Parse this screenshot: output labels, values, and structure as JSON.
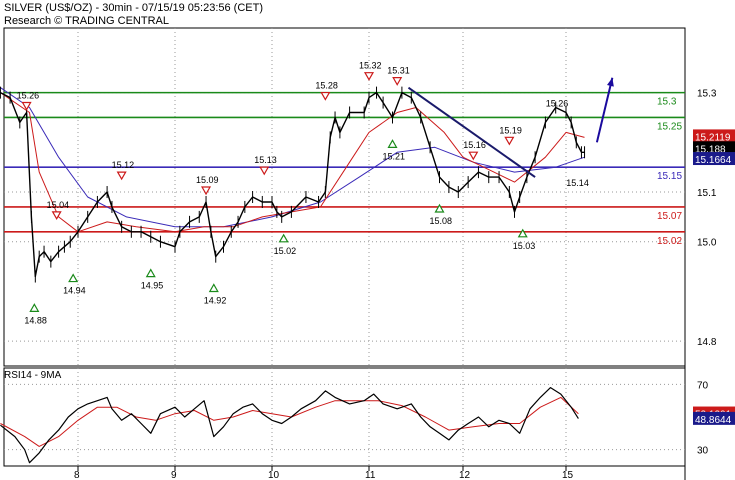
{
  "header": {
    "line1": "SILVER (US$/OZ) - 30min - 07/15/19 05:23:56 (CET)",
    "line2": "Research © TRADING CENTRAL"
  },
  "chart_data": [
    {
      "type": "line",
      "panel": "price",
      "ylim": [
        14.75,
        15.43
      ],
      "x_range": [
        7.2,
        16.2
      ],
      "yticks": [
        14.8,
        15.0,
        15.1,
        15.3
      ],
      "price_series": [
        [
          7.2,
          15.3
        ],
        [
          7.3,
          15.29
        ],
        [
          7.4,
          15.24
        ],
        [
          7.47,
          15.26
        ],
        [
          7.52,
          15.05
        ],
        [
          7.56,
          14.93
        ],
        [
          7.6,
          14.97
        ],
        [
          7.65,
          14.98
        ],
        [
          7.72,
          14.96
        ],
        [
          7.8,
          14.98
        ],
        [
          7.86,
          14.99
        ],
        [
          7.92,
          15.0
        ],
        [
          8.0,
          15.02
        ],
        [
          8.1,
          15.05
        ],
        [
          8.2,
          15.08
        ],
        [
          8.3,
          15.1
        ],
        [
          8.35,
          15.07
        ],
        [
          8.45,
          15.03
        ],
        [
          8.55,
          15.02
        ],
        [
          8.65,
          15.02
        ],
        [
          8.75,
          15.01
        ],
        [
          8.85,
          15.0
        ],
        [
          9.0,
          14.99
        ],
        [
          9.05,
          15.02
        ],
        [
          9.15,
          15.04
        ],
        [
          9.25,
          15.05
        ],
        [
          9.32,
          15.08
        ],
        [
          9.37,
          15.02
        ],
        [
          9.42,
          14.97
        ],
        [
          9.5,
          14.99
        ],
        [
          9.58,
          15.02
        ],
        [
          9.65,
          15.04
        ],
        [
          9.72,
          15.07
        ],
        [
          9.8,
          15.09
        ],
        [
          9.9,
          15.08
        ],
        [
          10.0,
          15.08
        ],
        [
          10.05,
          15.06
        ],
        [
          10.1,
          15.05
        ],
        [
          10.2,
          15.06
        ],
        [
          10.35,
          15.09
        ],
        [
          10.48,
          15.08
        ],
        [
          10.55,
          15.1
        ],
        [
          10.6,
          15.21
        ],
        [
          10.65,
          15.25
        ],
        [
          10.7,
          15.22
        ],
        [
          10.8,
          15.26
        ],
        [
          10.95,
          15.26
        ],
        [
          11.0,
          15.29
        ],
        [
          11.08,
          15.3
        ],
        [
          11.15,
          15.28
        ],
        [
          11.25,
          15.25
        ],
        [
          11.35,
          15.3
        ],
        [
          11.45,
          15.29
        ],
        [
          11.55,
          15.25
        ],
        [
          11.65,
          15.19
        ],
        [
          11.75,
          15.13
        ],
        [
          11.85,
          15.11
        ],
        [
          11.95,
          15.1
        ],
        [
          12.05,
          15.12
        ],
        [
          12.15,
          15.14
        ],
        [
          12.25,
          15.13
        ],
        [
          12.35,
          15.13
        ],
        [
          12.45,
          15.1
        ],
        [
          12.5,
          15.06
        ],
        [
          12.55,
          15.09
        ],
        [
          12.62,
          15.13
        ],
        [
          12.7,
          15.17
        ],
        [
          12.8,
          15.24
        ],
        [
          12.9,
          15.27
        ],
        [
          13.0,
          15.26
        ],
        [
          13.05,
          15.24
        ],
        [
          13.1,
          15.2
        ],
        [
          13.15,
          15.18
        ],
        [
          13.18,
          15.18
        ]
      ],
      "ma_series": [
        [
          7.2,
          15.3
        ],
        [
          7.5,
          15.26
        ],
        [
          7.6,
          15.14
        ],
        [
          7.8,
          15.05
        ],
        [
          8.0,
          15.02
        ],
        [
          8.3,
          15.04
        ],
        [
          8.6,
          15.03
        ],
        [
          9.0,
          15.02
        ],
        [
          9.3,
          15.03
        ],
        [
          9.6,
          15.03
        ],
        [
          9.9,
          15.05
        ],
        [
          10.2,
          15.06
        ],
        [
          10.5,
          15.07
        ],
        [
          10.8,
          15.16
        ],
        [
          11.0,
          15.22
        ],
        [
          11.3,
          15.26
        ],
        [
          11.5,
          15.27
        ],
        [
          11.8,
          15.22
        ],
        [
          12.0,
          15.17
        ],
        [
          12.3,
          15.14
        ],
        [
          12.5,
          15.12
        ],
        [
          12.8,
          15.17
        ],
        [
          13.0,
          15.22
        ],
        [
          13.18,
          15.21
        ]
      ],
      "ma_long_series": [
        [
          7.2,
          15.31
        ],
        [
          7.5,
          15.27
        ],
        [
          7.8,
          15.17
        ],
        [
          8.1,
          15.09
        ],
        [
          8.5,
          15.05
        ],
        [
          9.0,
          15.03
        ],
        [
          9.5,
          15.03
        ],
        [
          10.0,
          15.05
        ],
        [
          10.5,
          15.08
        ],
        [
          10.9,
          15.13
        ],
        [
          11.3,
          15.18
        ],
        [
          11.7,
          15.19
        ],
        [
          12.1,
          15.16
        ],
        [
          12.5,
          15.14
        ],
        [
          12.9,
          15.15
        ],
        [
          13.18,
          15.17
        ]
      ],
      "levels": [
        {
          "value": 15.3,
          "label": "15.3",
          "color": "#1a8a1a"
        },
        {
          "value": 15.25,
          "label": "15.25",
          "color": "#1a8a1a"
        },
        {
          "value": 15.15,
          "label": "15.15",
          "color": "#3a2ab8"
        },
        {
          "value": 15.07,
          "label": "15.07",
          "color": "#cc1a1a"
        },
        {
          "value": 15.02,
          "label": "15.02",
          "color": "#cc1a1a"
        }
      ],
      "trendline": {
        "x1": 11.42,
        "y1": 15.31,
        "x2": 12.7,
        "y2": 15.13,
        "color": "#1a1a6b"
      },
      "forecast_arrow": {
        "x1": 13.3,
        "y1": 15.2,
        "x2": 13.45,
        "y2": 15.33,
        "color": "#1a0a9e"
      },
      "pivot_labels": [
        {
          "x": 7.47,
          "y": 15.26,
          "text": "15.26",
          "kind": "high"
        },
        {
          "x": 7.78,
          "y": 15.04,
          "text": "15.04",
          "kind": "high"
        },
        {
          "x": 8.45,
          "y": 15.12,
          "text": "15.12",
          "kind": "high"
        },
        {
          "x": 9.32,
          "y": 15.09,
          "text": "15.09",
          "kind": "high"
        },
        {
          "x": 9.92,
          "y": 15.13,
          "text": "15.13",
          "kind": "high"
        },
        {
          "x": 10.55,
          "y": 15.28,
          "text": "15.28",
          "kind": "high"
        },
        {
          "x": 11.0,
          "y": 15.32,
          "text": "15.32",
          "kind": "high"
        },
        {
          "x": 11.3,
          "y": 15.31,
          "text": "15.31",
          "kind": "high"
        },
        {
          "x": 12.1,
          "y": 15.16,
          "text": "15.16",
          "kind": "high"
        },
        {
          "x": 12.45,
          "y": 15.19,
          "text": "15.19",
          "kind": "high"
        },
        {
          "x": 12.9,
          "y": 15.26,
          "text": "15.26",
          "kind": "level"
        },
        {
          "x": 7.55,
          "y": 14.88,
          "text": "14.88",
          "kind": "low"
        },
        {
          "x": 7.95,
          "y": 14.94,
          "text": "14.94",
          "kind": "low"
        },
        {
          "x": 8.75,
          "y": 14.95,
          "text": "14.95",
          "kind": "low"
        },
        {
          "x": 9.4,
          "y": 14.92,
          "text": "14.92",
          "kind": "low"
        },
        {
          "x": 10.12,
          "y": 15.02,
          "text": "15.02",
          "kind": "low"
        },
        {
          "x": 11.25,
          "y": 15.21,
          "text": "15.21",
          "kind": "low"
        },
        {
          "x": 11.75,
          "y": 15.08,
          "text": "15.08",
          "kind": "low"
        },
        {
          "x": 12.58,
          "y": 15.03,
          "text": "15.03",
          "kind": "low"
        },
        {
          "x": 13.1,
          "y": 15.14,
          "text": "15.14",
          "kind": "level"
        }
      ],
      "right_badges": [
        {
          "value": 15.2119,
          "text": "15.2119",
          "bg": "#cc1a1a",
          "fg": "#ffffff"
        },
        {
          "value": 15.188,
          "text": "15.188",
          "bg": "#000000",
          "fg": "#ffffff"
        },
        {
          "value": 15.1664,
          "text": "15.1664",
          "bg": "#1a1a8a",
          "fg": "#ffffff"
        }
      ],
      "colors": {
        "price": "#000000",
        "ma": "#cc1a1a",
        "ma_long": "#3a2ab8"
      }
    },
    {
      "type": "line",
      "panel": "rsi",
      "title": "RSI14 - 9MA",
      "ylim": [
        20,
        80
      ],
      "yticks": [
        30,
        70
      ],
      "rsi_series": [
        [
          7.2,
          45
        ],
        [
          7.35,
          38
        ],
        [
          7.45,
          30
        ],
        [
          7.5,
          22
        ],
        [
          7.6,
          28
        ],
        [
          7.7,
          36
        ],
        [
          7.8,
          42
        ],
        [
          7.9,
          50
        ],
        [
          8.0,
          55
        ],
        [
          8.1,
          58
        ],
        [
          8.2,
          60
        ],
        [
          8.3,
          62
        ],
        [
          8.35,
          55
        ],
        [
          8.45,
          48
        ],
        [
          8.55,
          52
        ],
        [
          8.65,
          46
        ],
        [
          8.75,
          40
        ],
        [
          8.85,
          52
        ],
        [
          9.0,
          56
        ],
        [
          9.1,
          50
        ],
        [
          9.2,
          55
        ],
        [
          9.3,
          60
        ],
        [
          9.4,
          38
        ],
        [
          9.5,
          44
        ],
        [
          9.6,
          52
        ],
        [
          9.7,
          56
        ],
        [
          9.8,
          58
        ],
        [
          9.9,
          52
        ],
        [
          10.0,
          48
        ],
        [
          10.1,
          46
        ],
        [
          10.2,
          50
        ],
        [
          10.3,
          55
        ],
        [
          10.45,
          60
        ],
        [
          10.55,
          66
        ],
        [
          10.65,
          62
        ],
        [
          10.8,
          58
        ],
        [
          10.95,
          60
        ],
        [
          11.05,
          64
        ],
        [
          11.15,
          58
        ],
        [
          11.3,
          55
        ],
        [
          11.45,
          58
        ],
        [
          11.55,
          50
        ],
        [
          11.65,
          44
        ],
        [
          11.75,
          40
        ],
        [
          11.85,
          36
        ],
        [
          11.95,
          42
        ],
        [
          12.05,
          46
        ],
        [
          12.15,
          50
        ],
        [
          12.25,
          44
        ],
        [
          12.35,
          48
        ],
        [
          12.45,
          46
        ],
        [
          12.55,
          40
        ],
        [
          12.65,
          55
        ],
        [
          12.75,
          62
        ],
        [
          12.85,
          68
        ],
        [
          12.95,
          64
        ],
        [
          13.05,
          56
        ],
        [
          13.12,
          49
        ]
      ],
      "rsi_ma_series": [
        [
          7.2,
          46
        ],
        [
          7.45,
          38
        ],
        [
          7.6,
          32
        ],
        [
          7.8,
          38
        ],
        [
          8.0,
          48
        ],
        [
          8.2,
          56
        ],
        [
          8.4,
          56
        ],
        [
          8.6,
          50
        ],
        [
          8.8,
          48
        ],
        [
          9.0,
          52
        ],
        [
          9.2,
          54
        ],
        [
          9.4,
          48
        ],
        [
          9.6,
          50
        ],
        [
          9.8,
          54
        ],
        [
          10.0,
          52
        ],
        [
          10.2,
          50
        ],
        [
          10.45,
          56
        ],
        [
          10.65,
          60
        ],
        [
          10.9,
          60
        ],
        [
          11.1,
          60
        ],
        [
          11.35,
          57
        ],
        [
          11.6,
          50
        ],
        [
          11.85,
          42
        ],
        [
          12.1,
          44
        ],
        [
          12.35,
          46
        ],
        [
          12.55,
          46
        ],
        [
          12.75,
          56
        ],
        [
          12.95,
          62
        ],
        [
          13.12,
          52
        ]
      ],
      "right_badges": [
        {
          "value": 52.1201,
          "text": "52.1201",
          "bg": "#cc1a1a",
          "fg": "#ffffff"
        },
        {
          "value": 48.8644,
          "text": "48.8644",
          "bg": "#1a1a8a",
          "fg": "#ffffff"
        }
      ],
      "colors": {
        "rsi": "#000000",
        "rsi_ma": "#cc1a1a"
      }
    }
  ],
  "x_axis": {
    "ticks": [
      {
        "x": 8,
        "label": "8"
      },
      {
        "x": 9,
        "label": "9"
      },
      {
        "x": 10,
        "label": "10"
      },
      {
        "x": 11,
        "label": "11"
      },
      {
        "x": 12,
        "label": "12"
      },
      {
        "x": 15,
        "label": "15"
      }
    ]
  }
}
